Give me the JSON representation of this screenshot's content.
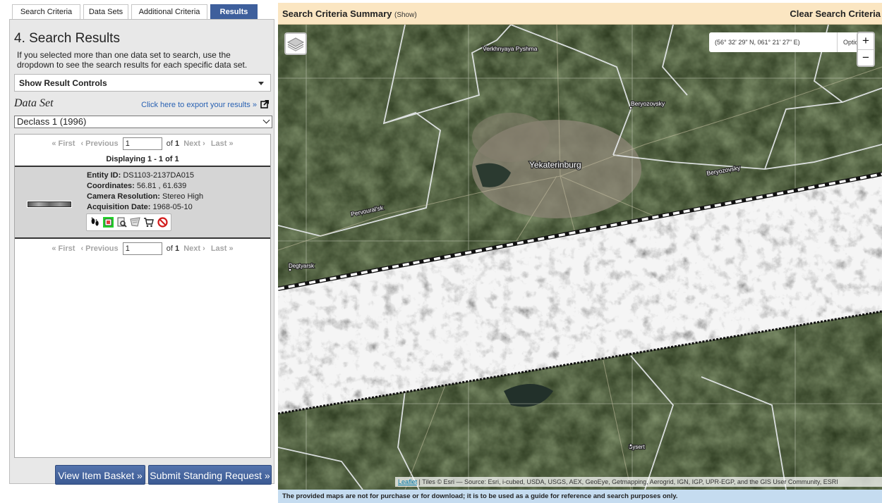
{
  "tabs": [
    {
      "label": "Search Criteria"
    },
    {
      "label": "Data Sets"
    },
    {
      "label": "Additional Criteria"
    },
    {
      "label": "Results"
    }
  ],
  "results": {
    "heading": "4. Search Results",
    "intro": "If you selected more than one data set to search, use the dropdown to see the search results for each specific data set.",
    "show_controls": "Show Result Controls",
    "dataset_label": "Data Set",
    "export_link": "Click here to export your results »",
    "dataset_selected": "Declass 1 (1996)",
    "pager": {
      "first": "« First",
      "prev": "‹ Previous",
      "page": "1",
      "of": "of",
      "total": "1",
      "next": "Next ›",
      "last": "Last »"
    },
    "displaying": "Displaying 1 - 1 of 1",
    "item": {
      "entity_label": "Entity ID:",
      "entity_value": "DS1103-2137DA015",
      "coords_label": "Coordinates:",
      "coords_value": "56.81 , 61.639",
      "cam_label": "Camera Resolution:",
      "cam_value": "Stereo High",
      "date_label": "Acquisition Date:",
      "date_value": "1968-05-10"
    },
    "item_icons": [
      "footprint-icon",
      "overlay-icon",
      "metadata-icon",
      "compare-icon",
      "cart-icon",
      "exclude-icon"
    ]
  },
  "buttons": {
    "basket": "View Item Basket »",
    "standing": "Submit Standing Request »"
  },
  "map": {
    "summary_title": "Search Criteria Summary",
    "summary_show": "(Show)",
    "clear": "Clear Search Criteria",
    "coords": "(56° 32' 29\" N, 061° 21' 27\" E)",
    "options": "Options",
    "zoom_in": "+",
    "zoom_out": "−",
    "places": [
      "Verkhnyaya Pyshma",
      "Beryozovsky",
      "Yekaterinburg",
      "Pervoural'sk",
      "Degtyarsk",
      "Sysert"
    ],
    "attribution_link": "Leaflet",
    "attribution": " | Tiles © Esri — Source: Esri, i-cubed, USDA, USGS, AEX, GeoEye, Getmapping, Aerogrid, IGN, IGP, UPR-EGP, and the GIS User Community, ESRI",
    "disclaimer": "The provided maps are not for purchase or for download; it is to be used as a guide for reference and search purposes only."
  },
  "colors": {
    "tab_active": "#3e5f9c",
    "button": "#4666a0",
    "summary_bg": "#fbe6c2",
    "disclaimer_bg": "#c5dcf0",
    "link": "#2a62b3"
  }
}
